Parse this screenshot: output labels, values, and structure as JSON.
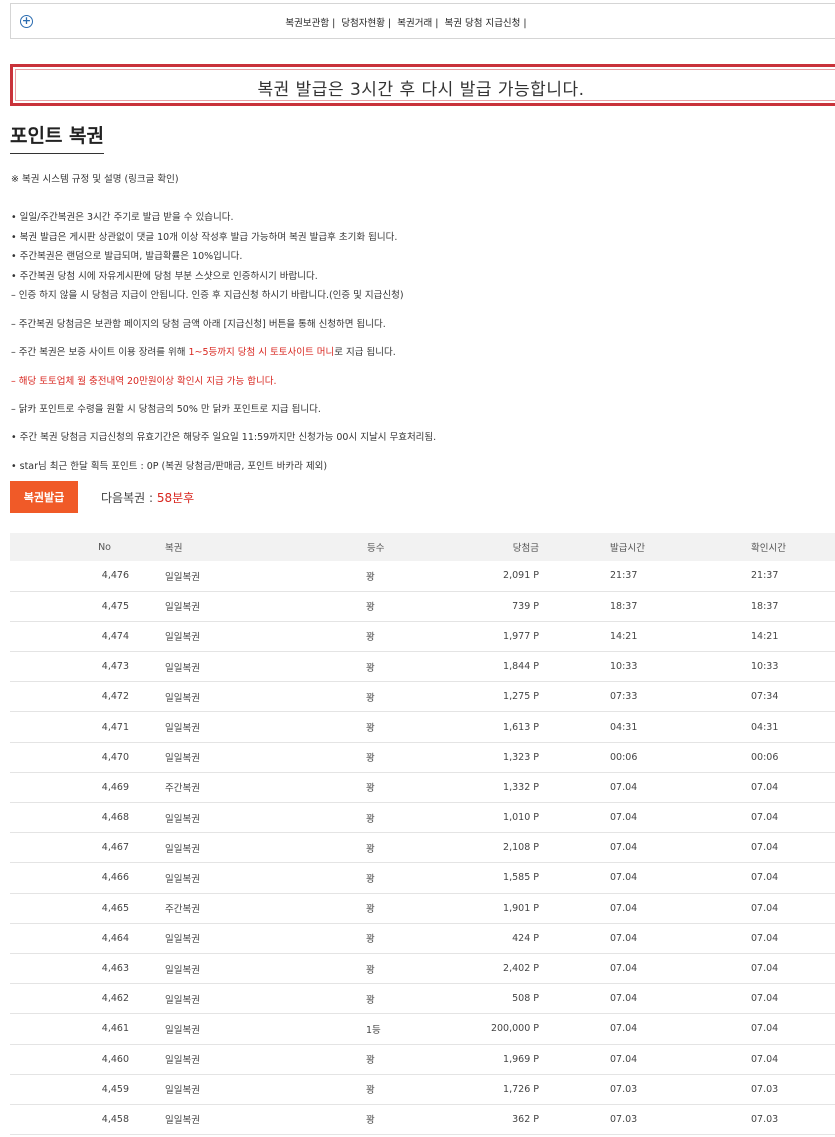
{
  "topnav": {
    "links": [
      "복권보관함",
      "당첨자현황",
      "복권거래",
      "복권 당첨 지급신청"
    ]
  },
  "notice": "복권 발급은 3시간 후 다시 발급 가능합니다.",
  "page_title": "포인트 복권",
  "rules_link": "※ 복권 시스템 규정 및 설명 (링크글 확인)",
  "rules": [
    {
      "text": "• 일일/주간복권은 3시간 주기로 발급 받을 수 있습니다."
    },
    {
      "text": "• 복권 발급은 게시판 상관없이 댓글 10개 이상 작성후 발급 가능하며 복권 발급후 초기화 됩니다."
    },
    {
      "text": "• 주간복권은 랜덤으로 발급되며, 발급확률은 10%입니다."
    },
    {
      "text": "• 주간복권 당첨 시에 자유게시판에 당첨 부분 스샷으로 인증하시기 바랍니다."
    },
    {
      "text": "  – 인증 하지 않을 시 당첨금 지급이 안됩니다. 인증 후 지급신청 하시기 바랍니다.(인증 및 지급신청)"
    },
    {
      "text": "  – 주간복권 당첨금은 보관함 페이지의 당첨 금액 아래 [지급신청] 버튼을 통해 신청하면 됩니다."
    },
    {
      "pre": "  – 주간 복권은 보증 사이트 이용 장려를 위해 ",
      "red": "1~5등까지 당첨 시 토토사이트 머니",
      "post": "로 지급 됩니다."
    },
    {
      "red": "  – 해당 토토업체 월 충전내역 20만원이상 확인시 지급 가능 합니다."
    },
    {
      "text": "  – 닭카 포인트로 수령을 원할 시 당첨금의 50% 만 닭카 포인트로 지급 됩니다."
    },
    {
      "text": "• 주간 복권 당첨금 지급신청의 유효기간은 해당주 일요일 11:59까지만 신청가능 00시 지날시 무효처리됨."
    },
    {
      "text": "• star님 최근 한달 획득 포인트 : 0P (복권 당첨금/판매금, 포인트 바카라 제외)"
    }
  ],
  "issue_button": "복권발급",
  "next_label": "다음복권 : ",
  "next_time": "58분후",
  "table": {
    "headers": [
      "No",
      "복권",
      "등수",
      "당첨금",
      "발급시간",
      "확인시간"
    ],
    "rows": [
      [
        "4,476",
        "일일복권",
        "꽝",
        "2,091 P",
        "21:37",
        "21:37"
      ],
      [
        "4,475",
        "일일복권",
        "꽝",
        "739 P",
        "18:37",
        "18:37"
      ],
      [
        "4,474",
        "일일복권",
        "꽝",
        "1,977 P",
        "14:21",
        "14:21"
      ],
      [
        "4,473",
        "일일복권",
        "꽝",
        "1,844 P",
        "10:33",
        "10:33"
      ],
      [
        "4,472",
        "일일복권",
        "꽝",
        "1,275 P",
        "07:33",
        "07:34"
      ],
      [
        "4,471",
        "일일복권",
        "꽝",
        "1,613 P",
        "04:31",
        "04:31"
      ],
      [
        "4,470",
        "일일복권",
        "꽝",
        "1,323 P",
        "00:06",
        "00:06"
      ],
      [
        "4,469",
        "주간복권",
        "꽝",
        "1,332 P",
        "07.04",
        "07.04"
      ],
      [
        "4,468",
        "일일복권",
        "꽝",
        "1,010 P",
        "07.04",
        "07.04"
      ],
      [
        "4,467",
        "일일복권",
        "꽝",
        "2,108 P",
        "07.04",
        "07.04"
      ],
      [
        "4,466",
        "일일복권",
        "꽝",
        "1,585 P",
        "07.04",
        "07.04"
      ],
      [
        "4,465",
        "주간복권",
        "꽝",
        "1,901 P",
        "07.04",
        "07.04"
      ],
      [
        "4,464",
        "일일복권",
        "꽝",
        "424 P",
        "07.04",
        "07.04"
      ],
      [
        "4,463",
        "일일복권",
        "꽝",
        "2,402 P",
        "07.04",
        "07.04"
      ],
      [
        "4,462",
        "일일복권",
        "꽝",
        "508 P",
        "07.04",
        "07.04"
      ],
      [
        "4,461",
        "일일복권",
        "1등",
        "200,000 P",
        "07.04",
        "07.04"
      ],
      [
        "4,460",
        "일일복권",
        "꽝",
        "1,969 P",
        "07.04",
        "07.04"
      ],
      [
        "4,459",
        "일일복권",
        "꽝",
        "1,726 P",
        "07.03",
        "07.03"
      ],
      [
        "4,458",
        "일일복권",
        "꽝",
        "362 P",
        "07.03",
        "07.03"
      ]
    ]
  }
}
